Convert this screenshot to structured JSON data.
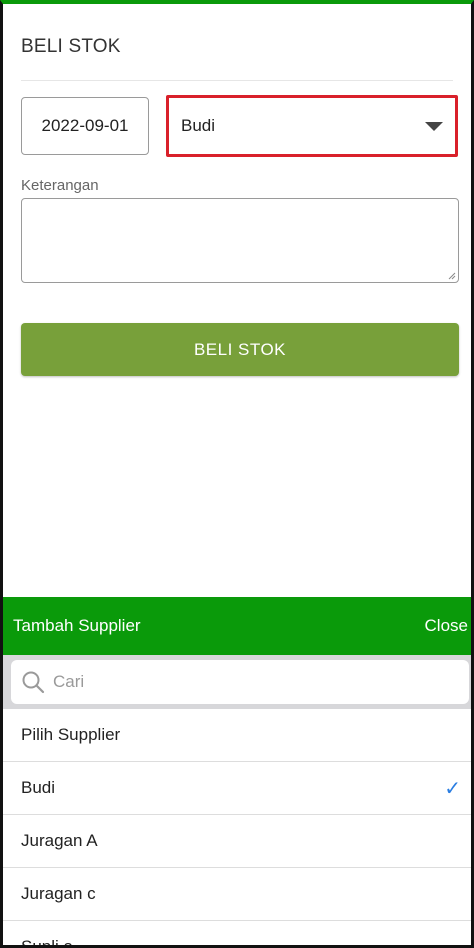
{
  "form": {
    "title": "BELI STOK",
    "date_value": "2022-09-01",
    "supplier_value": "Budi",
    "keterangan_label": "Keterangan",
    "keterangan_value": "",
    "submit_label": "BELI STOK"
  },
  "sheet": {
    "add_label": "Tambah Supplier",
    "close_label": "Close",
    "search_placeholder": "Cari",
    "items": [
      {
        "label": "Pilih Supplier",
        "selected": false
      },
      {
        "label": "Budi",
        "selected": true
      },
      {
        "label": "Juragan A",
        "selected": false
      },
      {
        "label": "Juragan c",
        "selected": false
      },
      {
        "label": "Supli a",
        "selected": false
      }
    ],
    "check_glyph": "✓"
  },
  "colors": {
    "header_green": "#0a9a0a",
    "button_green": "#78a03a",
    "select_border": "#d9202a",
    "check_blue": "#2a7de1"
  },
  "icons": {
    "search": "search-icon",
    "dropdown": "caret-down-icon",
    "check": "checkmark-icon"
  }
}
